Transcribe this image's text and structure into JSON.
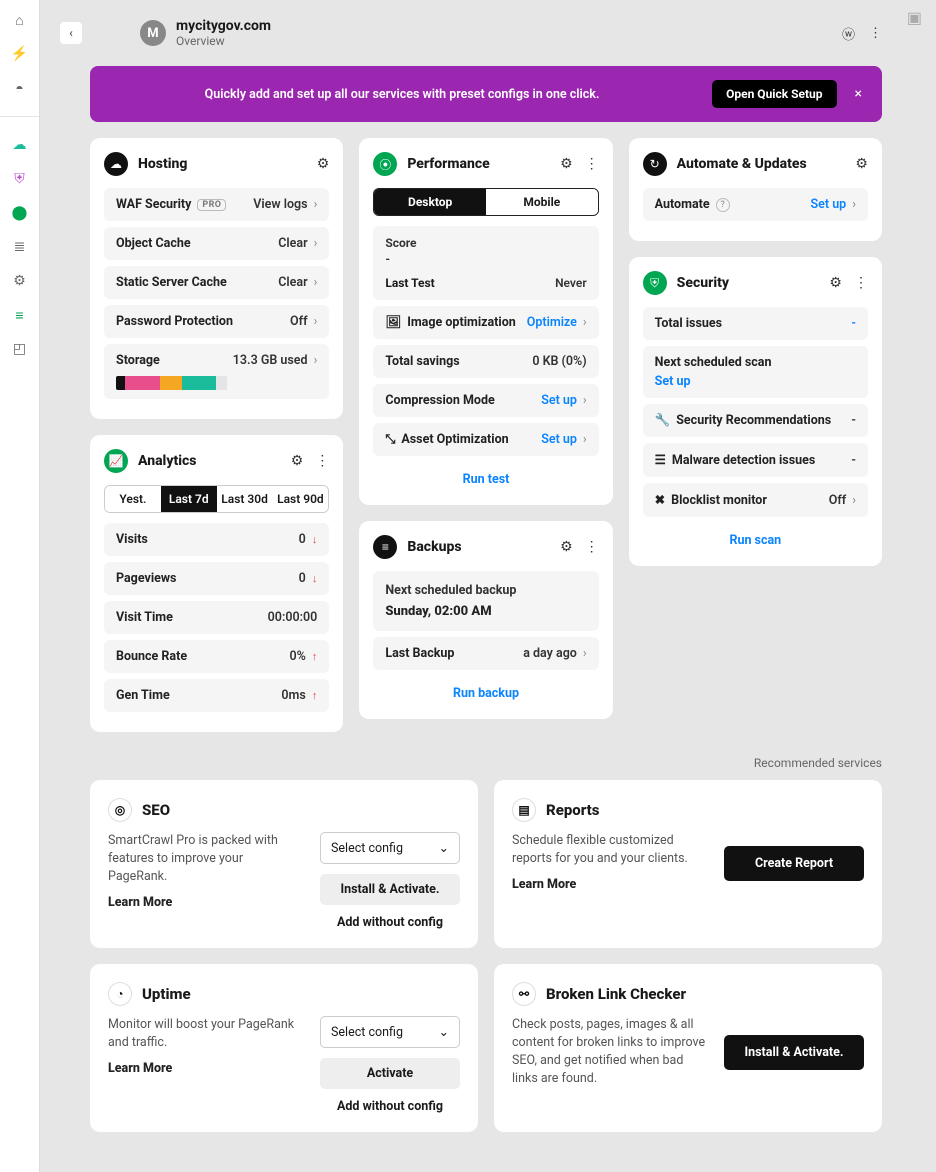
{
  "header": {
    "back_glyph": "‹",
    "avatar_letter": "M",
    "title": "mycitygov.com",
    "subtitle": "Overview",
    "wp_icon": "ⓦ",
    "more_icon": "⋮"
  },
  "sidenav": {
    "home": "⌂",
    "plug": "⚡",
    "globe": "◓",
    "cloud": "☁",
    "shield": "⛨",
    "speed": "⬤",
    "layers": "≣",
    "robot": "⚙",
    "bars": "≡",
    "box": "◰"
  },
  "banner": {
    "message": "Quickly add and set up all our services with preset configs in one click.",
    "cta": "Open Quick Setup",
    "close": "×"
  },
  "hosting": {
    "title": "Hosting",
    "rows": [
      {
        "label": "WAF Security",
        "badge": "PRO",
        "value": "View logs"
      },
      {
        "label": "Object Cache",
        "value": "Clear"
      },
      {
        "label": "Static Server Cache",
        "value": "Clear"
      },
      {
        "label": "Password Protection",
        "value": "Off"
      }
    ],
    "storage": {
      "label": "Storage",
      "value": "13.3 GB used"
    }
  },
  "performance": {
    "title": "Performance",
    "tabs": [
      "Desktop",
      "Mobile"
    ],
    "score_label": "Score",
    "score_value": "-",
    "last_test_label": "Last Test",
    "last_test_value": "Never",
    "rows": [
      {
        "icon": "🖼",
        "label": "Image optimization",
        "value": "Optimize",
        "link": true
      },
      {
        "label": "Total savings",
        "value": "0 KB (0%)"
      },
      {
        "label": "Compression Mode",
        "value": "Set up",
        "link": true
      },
      {
        "icon": "⤡",
        "label": "Asset Optimization",
        "value": "Set up",
        "link": true
      }
    ],
    "footer": "Run test"
  },
  "automate": {
    "title": "Automate & Updates",
    "row": {
      "label": "Automate",
      "help": "?",
      "value": "Set up"
    }
  },
  "security": {
    "title": "Security",
    "total_issues": {
      "label": "Total issues",
      "value": "-"
    },
    "next_scan_label": "Next scheduled scan",
    "setup": "Set up",
    "rows": [
      {
        "icon": "🔧",
        "label": "Security Recommendations",
        "value": "-"
      },
      {
        "icon": "☰",
        "label": "Malware detection issues",
        "value": "-"
      },
      {
        "icon": "✖",
        "label": "Blocklist monitor",
        "value": "Off"
      }
    ],
    "footer": "Run scan"
  },
  "analytics": {
    "title": "Analytics",
    "tabs": [
      "Yest.",
      "Last 7d",
      "Last 30d",
      "Last 90d"
    ],
    "rows": [
      {
        "label": "Visits",
        "value": "0",
        "dir": "down"
      },
      {
        "label": "Pageviews",
        "value": "0",
        "dir": "down"
      },
      {
        "label": "Visit Time",
        "value": "00:00:00"
      },
      {
        "label": "Bounce Rate",
        "value": "0%",
        "dir": "up"
      },
      {
        "label": "Gen Time",
        "value": "0ms",
        "dir": "up"
      }
    ]
  },
  "backups": {
    "title": "Backups",
    "next_label": "Next scheduled backup",
    "next_value": "Sunday, 02:00 AM",
    "last_label": "Last Backup",
    "last_value": "a day ago",
    "footer": "Run backup"
  },
  "recommended": {
    "heading": "Recommended services",
    "seo": {
      "title": "SEO",
      "text": "SmartCrawl Pro is packed with features to improve your PageRank.",
      "learn": "Learn More",
      "select": "Select config",
      "install": "Install & Activate.",
      "add": "Add without config"
    },
    "reports": {
      "title": "Reports",
      "text": "Schedule flexible customized reports for you and your clients.",
      "learn": "Learn More",
      "cta": "Create Report"
    },
    "uptime": {
      "title": "Uptime",
      "text": "Monitor will boost your PageRank and traffic.",
      "learn": "Learn More",
      "select": "Select config",
      "activate": "Activate",
      "add": "Add without config"
    },
    "blc": {
      "title": "Broken Link Checker",
      "text": "Check posts, pages, images & all content for broken links to improve SEO, and get notified when bad links are found.",
      "cta": "Install & Activate."
    }
  }
}
